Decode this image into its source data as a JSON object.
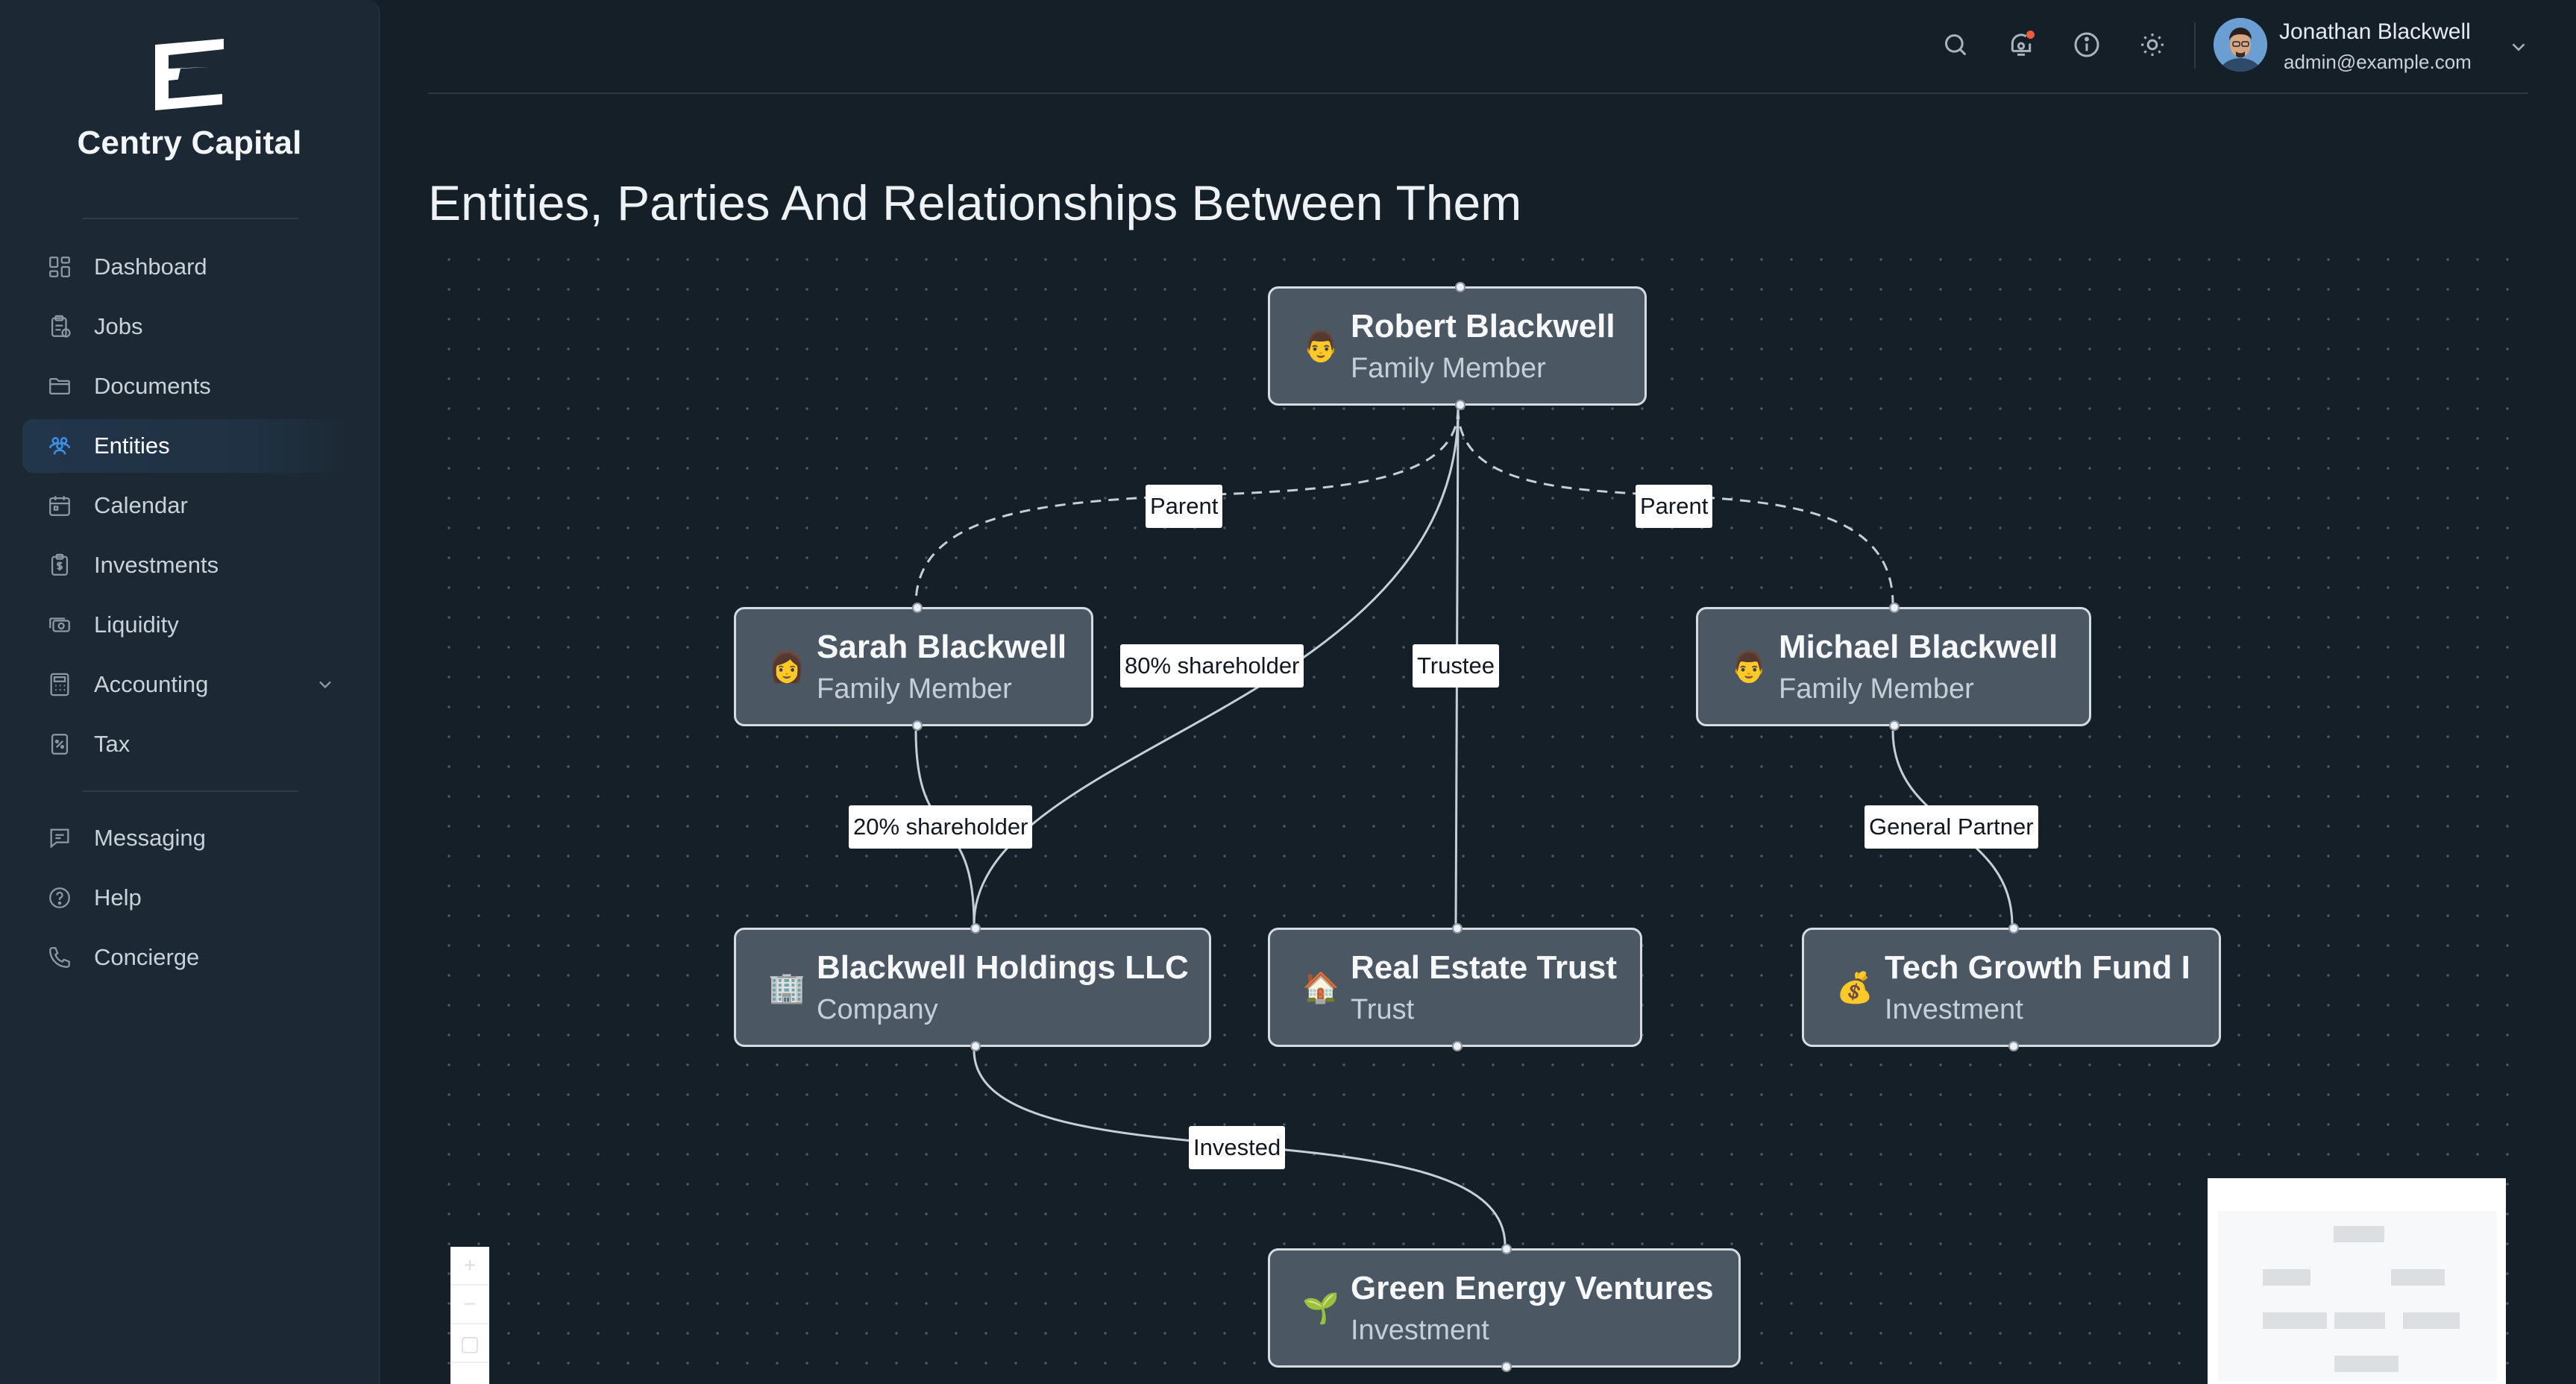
{
  "brand": {
    "name": "Centry Capital"
  },
  "nav": {
    "items": [
      {
        "label": "Dashboard",
        "icon": "dashboard-icon"
      },
      {
        "label": "Jobs",
        "icon": "clipboard-icon"
      },
      {
        "label": "Documents",
        "icon": "folder-icon"
      },
      {
        "label": "Entities",
        "icon": "people-icon",
        "active": true
      },
      {
        "label": "Calendar",
        "icon": "calendar-icon"
      },
      {
        "label": "Investments",
        "icon": "investments-icon"
      },
      {
        "label": "Liquidity",
        "icon": "cash-icon"
      },
      {
        "label": "Accounting",
        "icon": "calculator-icon",
        "expandable": true
      },
      {
        "label": "Tax",
        "icon": "tax-icon"
      }
    ],
    "secondary": [
      {
        "label": "Messaging",
        "icon": "message-icon"
      },
      {
        "label": "Help",
        "icon": "help-icon"
      },
      {
        "label": "Concierge",
        "icon": "phone-icon"
      }
    ]
  },
  "header": {
    "icons": [
      "search-icon",
      "notification-icon",
      "info-icon",
      "theme-toggle-icon"
    ],
    "has_notification": true,
    "user": {
      "name": "Jonathan Blackwell",
      "email": "admin@example.com"
    }
  },
  "page": {
    "title": "Entities, Parties And Relationships Between Them"
  },
  "graph": {
    "nodes": {
      "robert": {
        "name": "Robert Blackwell",
        "type": "Family Member",
        "emoji": "👨"
      },
      "sarah": {
        "name": "Sarah Blackwell",
        "type": "Family Member",
        "emoji": "👩"
      },
      "michael": {
        "name": "Michael Blackwell",
        "type": "Family Member",
        "emoji": "👨"
      },
      "holdings": {
        "name": "Blackwell Holdings LLC",
        "type": "Company",
        "emoji": "🏢"
      },
      "trust": {
        "name": "Real Estate Trust",
        "type": "Trust",
        "emoji": "🏠"
      },
      "fund": {
        "name": "Tech Growth Fund I",
        "type": "Investment",
        "emoji": "💰"
      },
      "green": {
        "name": "Green Energy Ventures",
        "type": "Investment",
        "emoji": "🌱"
      }
    },
    "edges": {
      "parent_sarah": {
        "from": "robert",
        "to": "sarah",
        "label": "Parent",
        "style": "dashed"
      },
      "parent_michael": {
        "from": "robert",
        "to": "michael",
        "label": "Parent",
        "style": "dashed"
      },
      "robert_holdings": {
        "from": "robert",
        "to": "holdings",
        "label": "80% shareholder",
        "style": "solid"
      },
      "robert_trust": {
        "from": "robert",
        "to": "trust",
        "label": "Trustee",
        "style": "solid"
      },
      "sarah_holdings": {
        "from": "sarah",
        "to": "holdings",
        "label": "20% shareholder",
        "style": "solid"
      },
      "michael_fund": {
        "from": "michael",
        "to": "fund",
        "label": "General Partner",
        "style": "solid"
      },
      "holdings_green": {
        "from": "holdings",
        "to": "green",
        "label": "Invested",
        "style": "solid"
      }
    }
  },
  "colors": {
    "background": "#151f28",
    "sidebar": "#1c2833",
    "node": "#4b5863",
    "accent": "#3b8fe6",
    "notification": "#ef5a3c"
  }
}
